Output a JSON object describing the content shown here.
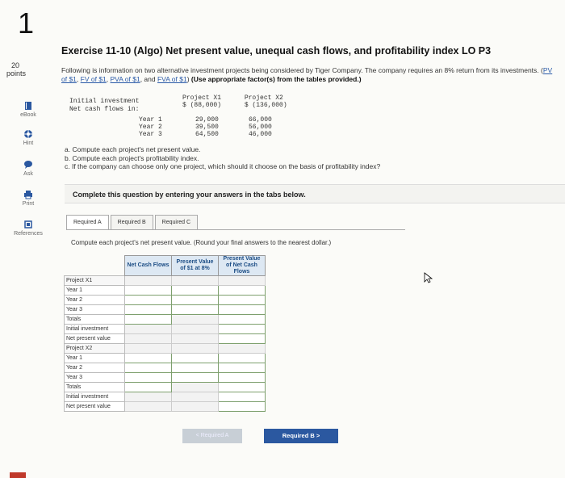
{
  "question_number": "1",
  "points": {
    "value": "20",
    "label": "points"
  },
  "sidebar": {
    "items": [
      {
        "label": "eBook",
        "icon": "book-icon"
      },
      {
        "label": "Hint",
        "icon": "lifebuoy-icon"
      },
      {
        "label": "Ask",
        "icon": "chat-icon"
      },
      {
        "label": "Print",
        "icon": "printer-icon"
      },
      {
        "label": "References",
        "icon": "references-icon"
      }
    ]
  },
  "exercise": {
    "title": "Exercise 11-10 (Algo) Net present value, unequal cash flows, and profitability index LO P3",
    "intro_text": "Following is information on two alternative investment projects being considered by Tiger Company. The company requires an 8% return from its investments.",
    "links": [
      "PV of $1",
      "FV of $1",
      "PVA of $1",
      "FVA of $1"
    ],
    "instruction_bold": "(Use appropriate factor(s) from the tables provided.)"
  },
  "projects": {
    "header_row1": "Project X1      Project X2",
    "header_row2": "$ (88,000)      $ (136,000)",
    "label_initial": "Initial investment",
    "label_cash": "Net cash flows in:",
    "years": [
      "Year 1",
      "Year 2",
      "Year 3"
    ],
    "x1_values": [
      "29,000",
      "39,500",
      "64,500"
    ],
    "x2_values": [
      "66,000",
      "56,000",
      "46,000"
    ]
  },
  "tasks": [
    "a. Compute each project's net present value.",
    "b. Compute each project's profitability index.",
    "c. If the company can choose only one project, which should it choose on the basis of profitability index?"
  ],
  "complete_text": "Complete this question by entering your answers in the tabs below.",
  "tabs": [
    "Required A",
    "Required B",
    "Required C"
  ],
  "required_a": {
    "instruction": "Compute each project's net present value. (Round your final answers to the nearest dollar.)",
    "columns": [
      "Net Cash Flows",
      "Present Value of $1 at 8%",
      "Present Value of Net Cash Flows"
    ],
    "rows": [
      "Project X1",
      "Year 1",
      "Year 2",
      "Year 3",
      "Totals",
      "Initial investment",
      "Net present value",
      "Project X2",
      "Year 1",
      "Year 2",
      "Year 3",
      "Totals",
      "Initial investment",
      "Net present value"
    ]
  },
  "nav": {
    "prev_label": "< Required A",
    "next_label": "Required B  >"
  }
}
